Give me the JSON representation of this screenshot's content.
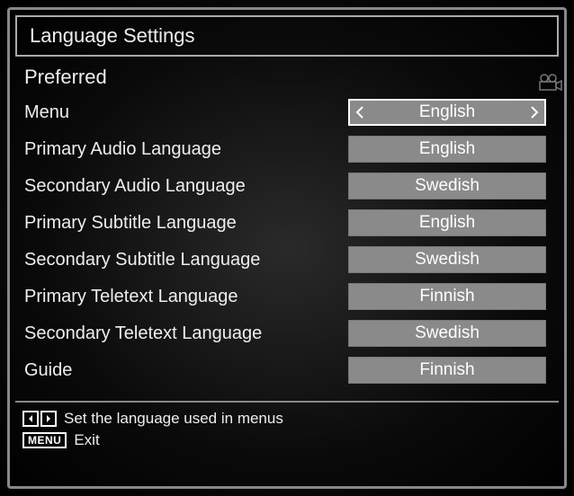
{
  "title": "Language Settings",
  "section": "Preferred",
  "settings": [
    {
      "label": "Menu",
      "value": "English",
      "selected": true
    },
    {
      "label": "Primary Audio Language",
      "value": "English",
      "selected": false
    },
    {
      "label": "Secondary Audio Language",
      "value": "Swedish",
      "selected": false
    },
    {
      "label": "Primary Subtitle Language",
      "value": "English",
      "selected": false
    },
    {
      "label": "Secondary Subtitle Language",
      "value": "Swedish",
      "selected": false
    },
    {
      "label": "Primary Teletext Language",
      "value": "Finnish",
      "selected": false
    },
    {
      "label": "Secondary Teletext Language",
      "value": "Swedish",
      "selected": false
    },
    {
      "label": "Guide",
      "value": "Finnish",
      "selected": false
    }
  ],
  "help": {
    "nav_hint": "Set the language used in menus",
    "menu_hint": "Exit",
    "menu_key_label": "MENU"
  }
}
